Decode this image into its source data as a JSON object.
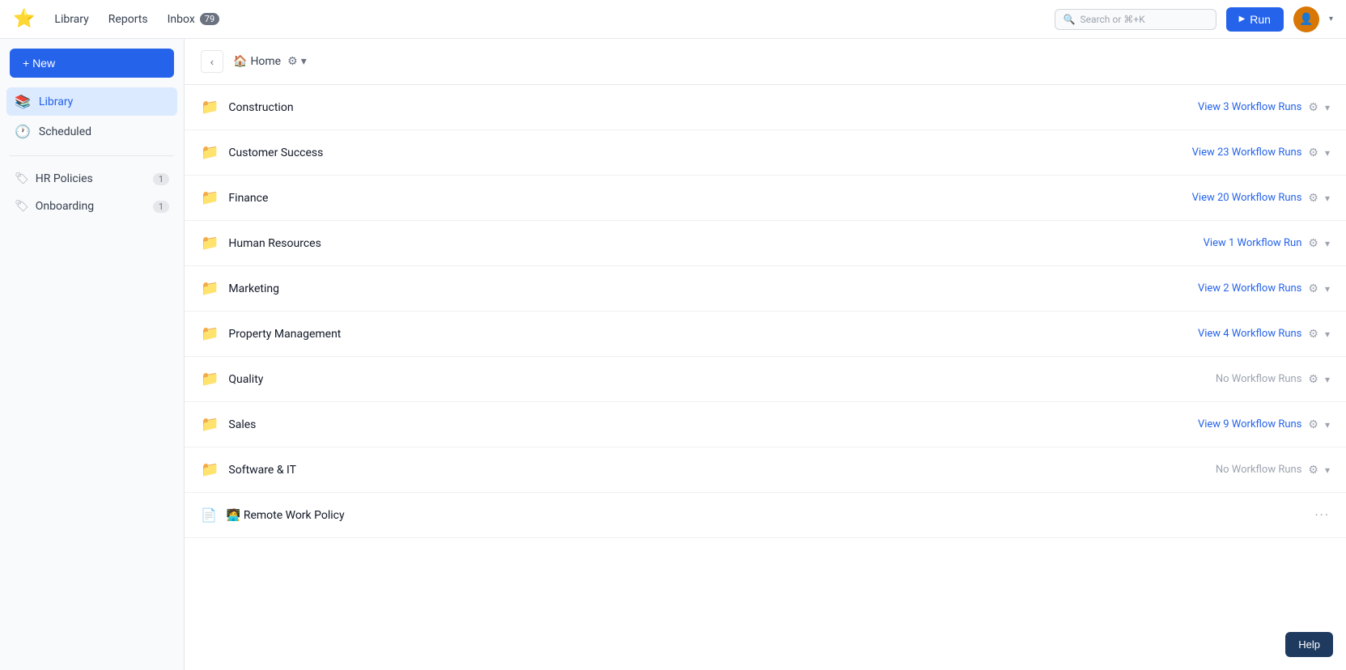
{
  "topNav": {
    "libraryLabel": "Library",
    "reportsLabel": "Reports",
    "inboxLabel": "Inbox",
    "inboxBadge": "79",
    "searchPlaceholder": "Search or ⌘+K",
    "runLabel": "Run",
    "avatarAlt": "User avatar"
  },
  "sidebar": {
    "newLabel": "+ New",
    "libraryLabel": "Library",
    "scheduledLabel": "Scheduled",
    "tags": [
      {
        "label": "HR Policies",
        "count": "1"
      },
      {
        "label": "Onboarding",
        "count": "1"
      }
    ]
  },
  "breadcrumb": {
    "homeLabel": "Home"
  },
  "folders": [
    {
      "name": "Construction",
      "runs": "View 3 Workflow Runs",
      "hasRuns": true
    },
    {
      "name": "Customer Success",
      "runs": "View 23 Workflow Runs",
      "hasRuns": true
    },
    {
      "name": "Finance",
      "runs": "View 20 Workflow Runs",
      "hasRuns": true
    },
    {
      "name": "Human Resources",
      "runs": "View 1 Workflow Run",
      "hasRuns": true
    },
    {
      "name": "Marketing",
      "runs": "View 2 Workflow Runs",
      "hasRuns": true
    },
    {
      "name": "Property Management",
      "runs": "View 4 Workflow Runs",
      "hasRuns": true
    },
    {
      "name": "Quality",
      "runs": "No Workflow Runs",
      "hasRuns": false
    },
    {
      "name": "Sales",
      "runs": "View 9 Workflow Runs",
      "hasRuns": true
    },
    {
      "name": "Software & IT",
      "runs": "No Workflow Runs",
      "hasRuns": false
    }
  ],
  "document": {
    "name": "🧑‍💻 Remote Work Policy"
  },
  "help": {
    "label": "Help"
  }
}
